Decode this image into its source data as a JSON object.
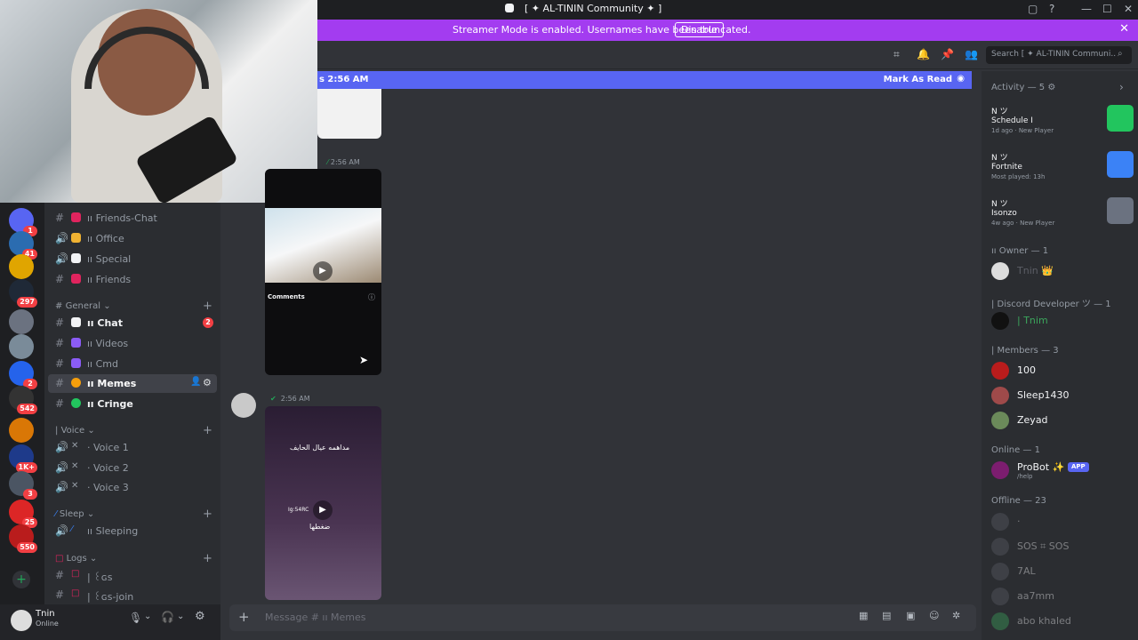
{
  "window": {
    "title": "[ ✦ AL-TININ Community ✦ ]",
    "controls": [
      "—",
      "☐",
      "✕"
    ]
  },
  "banner": {
    "message": "Streamer Mode is enabled. Usernames have been truncated.",
    "disable_label": "Disable"
  },
  "header": {
    "search_placeholder": "Search [ ✦ AL-TININ Communi..."
  },
  "new_messages": {
    "since": "s 2:56 AM",
    "mark_read": "Mark As Read"
  },
  "servers": [
    {
      "color": "#5865f2",
      "badge": "1"
    },
    {
      "color": "#2b6cb0",
      "badge": "41"
    },
    {
      "color": "#e0a500",
      "badge": ""
    },
    {
      "color": "#1f2937",
      "badge": "297"
    },
    {
      "color": "#6b7280",
      "badge": ""
    },
    {
      "color": "#7a8b99",
      "badge": ""
    },
    {
      "color": "#2563eb",
      "badge": "2"
    },
    {
      "color": "#333",
      "badge": "542"
    },
    {
      "color": "#d97706",
      "badge": ""
    },
    {
      "color": "#1e3a8a",
      "badge": "1K+"
    },
    {
      "color": "#4b5563",
      "badge": "3"
    },
    {
      "color": "#dc2626",
      "badge": "25"
    },
    {
      "color": "#b91c1c",
      "badge": "550"
    }
  ],
  "channels": {
    "top": [
      {
        "name": "ıı Friends-Chat",
        "emoji_color": "#e0245e"
      },
      {
        "name": "ıı Office",
        "emoji_color": "#f0b232"
      },
      {
        "name": "ıı Special",
        "emoji_color": "#f2f3f5"
      },
      {
        "name": "ıı Friends",
        "emoji_color": "#e0245e"
      }
    ],
    "general_label": "General",
    "general": [
      {
        "name": "ıı Chat",
        "emoji_color": "#f2f3f5",
        "badge": "2",
        "bold": true
      },
      {
        "name": "ıı Videos",
        "emoji_color": "#8b5cf6",
        "badge": "",
        "bold": false
      },
      {
        "name": "ıı Cmd",
        "emoji_color": "#8b5cf6",
        "badge": "",
        "bold": false
      },
      {
        "name": "ıı Memes",
        "emoji_color": "#f59e0b",
        "badge": "",
        "bold": true,
        "active": true
      },
      {
        "name": "ıı Cringe",
        "emoji_color": "#22c55e",
        "badge": "",
        "bold": true
      }
    ],
    "voice_label": "Voice",
    "voice": [
      "· Voice 1",
      "· Voice 2",
      "· Voice 3"
    ],
    "sleep_label": "Sleep",
    "sleep": [
      "ıı Sleeping"
    ],
    "logs_label": "Logs",
    "logs": [
      "| ꒰ɢs",
      "| ꒰ɢs-join"
    ]
  },
  "user": {
    "name": "Tnin",
    "status": "Online"
  },
  "messages": [
    {
      "time": "2:56 AM",
      "label": "Comments"
    },
    {
      "time": "2:56 AM",
      "overlay_top": "مداهمه عيال الحايف",
      "overlay_mid": "Ig:54RC",
      "overlay_bottom": "ضغطها"
    }
  ],
  "composer": {
    "placeholder": "Message # ıı Memes"
  },
  "members": {
    "activity_label": "Activity — 5",
    "activity": [
      {
        "user": "N ツ",
        "game": "Schedule I",
        "detail": "1d ago · New Player",
        "color": "#22c55e"
      },
      {
        "user": "N ツ",
        "game": "Fortnite",
        "detail": "Most played: 13h",
        "color": "#3b82f6"
      },
      {
        "user": "N ツ",
        "game": "Isonzo",
        "detail": "4w ago · New Player",
        "color": "#6b7280"
      }
    ],
    "owner_label": "ıı Owner — 1",
    "owner": "Tnin 👑",
    "dev_label": "| Discord Developer ツ — 1",
    "dev": "| Tnim",
    "members_label": "| Members — 3",
    "members": [
      "100",
      "Sleep1430",
      "Zeyad"
    ],
    "online_label": "Online — 1",
    "bot": {
      "name": "ProBot ✨",
      "tag": "APP",
      "sub": "/help"
    },
    "offline_label": "Offline — 23",
    "offline": [
      "·",
      "SOS ⌗ SOS",
      "7AL",
      "aa7mm",
      "abo khaled"
    ]
  }
}
